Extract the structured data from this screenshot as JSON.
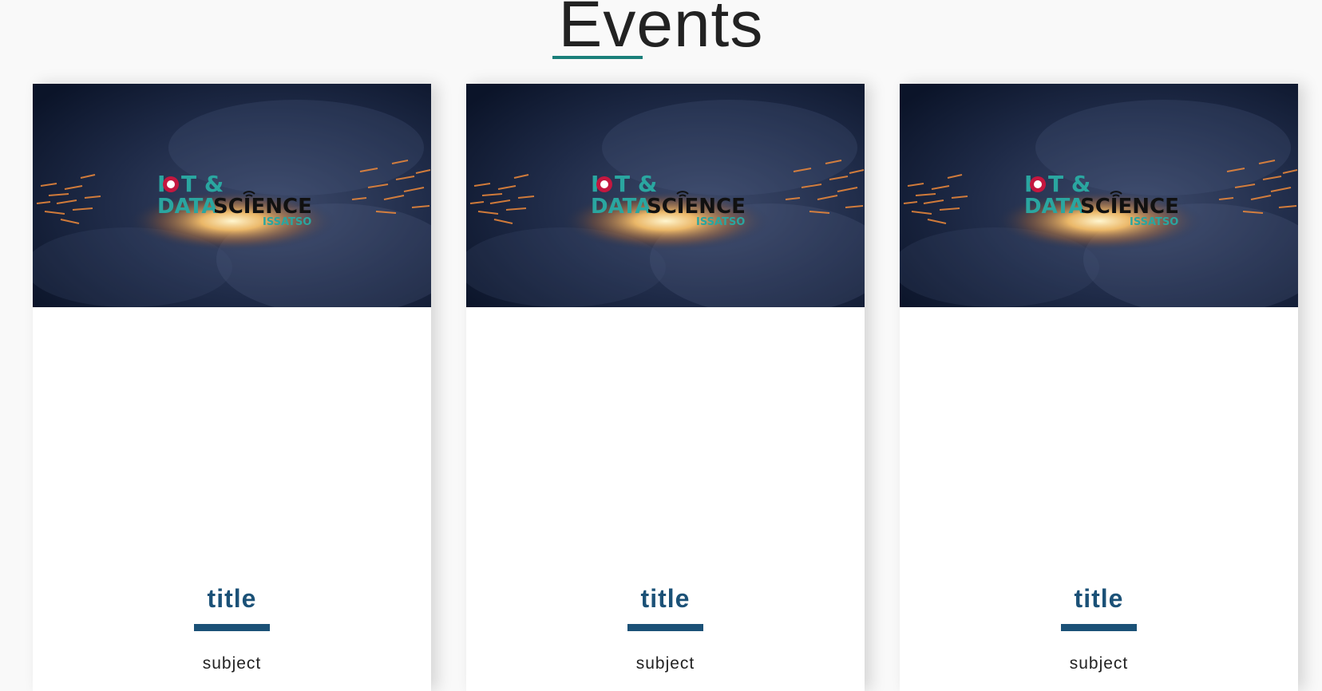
{
  "header": {
    "title": "Events"
  },
  "colors": {
    "accent_underline": "#1a7f7a",
    "card_title": "#1b5177",
    "banner_dark": "#0f1a33",
    "logo_teal": "#2aa6a0",
    "logo_red": "#c4173f"
  },
  "events": [
    {
      "banner": {
        "logo_line1": "I",
        "logo_line1b": "T &",
        "logo_line2a": "DATA",
        "logo_line2b": "SCIENCE",
        "logo_line3": "ISSATSO"
      },
      "title": "title",
      "subject": "subject"
    },
    {
      "banner": {
        "logo_line1": "I",
        "logo_line1b": "T &",
        "logo_line2a": "DATA",
        "logo_line2b": "SCIENCE",
        "logo_line3": "ISSATSO"
      },
      "title": "title",
      "subject": "subject"
    },
    {
      "banner": {
        "logo_line1": "I",
        "logo_line1b": "T &",
        "logo_line2a": "DATA",
        "logo_line2b": "SCIENCE",
        "logo_line3": "ISSATSO"
      },
      "title": "title",
      "subject": "subject"
    }
  ]
}
